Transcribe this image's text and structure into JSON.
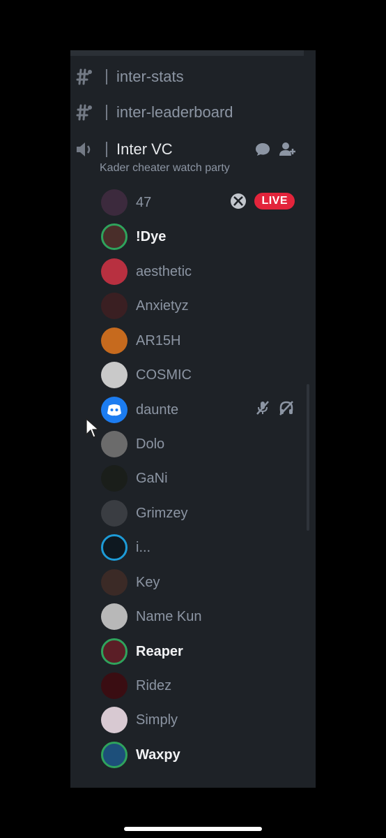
{
  "channels": [
    {
      "label": "inter-stats",
      "icon": "hashtag-voice-icon"
    },
    {
      "label": "inter-leaderboard",
      "icon": "hashtag-voice-icon"
    }
  ],
  "voice_channel": {
    "label": "Inter VC",
    "status": "Kader cheater watch party",
    "icon": "speaker-icon"
  },
  "members": [
    {
      "name": "47",
      "active": false,
      "live": true,
      "live_label": "LIVE",
      "platform_icon": "xbox-icon",
      "avatar_color": "#3c2a3d"
    },
    {
      "name": "!Dye",
      "active": true,
      "avatar_color": "#4a2e2a"
    },
    {
      "name": "aesthetic",
      "active": false,
      "avatar_color": "#b83040"
    },
    {
      "name": "Anxietyz",
      "active": false,
      "avatar_color": "#3a1f22"
    },
    {
      "name": "AR15H",
      "active": false,
      "avatar_color": "#c66a1e"
    },
    {
      "name": "COSMIC",
      "active": false,
      "avatar_color": "#c9c9c9"
    },
    {
      "name": "daunte",
      "active": false,
      "muted": true,
      "deafened": true,
      "avatar_color": "#1c7cf0"
    },
    {
      "name": "Dolo",
      "active": false,
      "avatar_color": "#6b6b6b"
    },
    {
      "name": "GaNi",
      "active": false,
      "avatar_color": "#1a1e1a"
    },
    {
      "name": "Grimzey",
      "active": false,
      "avatar_color": "#3a3d42"
    },
    {
      "name": "i...",
      "active": false,
      "avatar_color": "#0e1820"
    },
    {
      "name": "Key",
      "active": false,
      "avatar_color": "#3b2a26"
    },
    {
      "name": "Name Kun",
      "active": false,
      "avatar_color": "#b8b8b8"
    },
    {
      "name": "Reaper",
      "active": true,
      "avatar_color": "#5b1e26"
    },
    {
      "name": "Ridez",
      "active": false,
      "avatar_color": "#3a0d12"
    },
    {
      "name": "Simply",
      "active": false,
      "avatar_color": "#d8c9d2"
    },
    {
      "name": "Waxpy",
      "active": true,
      "avatar_color": "#1d4f7a"
    }
  ]
}
